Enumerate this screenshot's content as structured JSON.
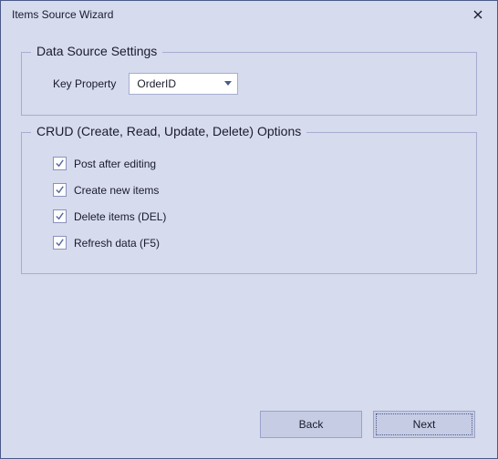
{
  "window": {
    "title": "Items Source Wizard"
  },
  "dataSource": {
    "legend": "Data Source Settings",
    "keyPropertyLabel": "Key Property",
    "keyPropertyValue": "OrderID"
  },
  "crud": {
    "legend": "CRUD (Create, Read, Update, Delete) Options",
    "options": [
      {
        "label": "Post after editing",
        "checked": true
      },
      {
        "label": "Create new items",
        "checked": true
      },
      {
        "label": "Delete items (DEL)",
        "checked": true
      },
      {
        "label": "Refresh data (F5)",
        "checked": true
      }
    ]
  },
  "buttons": {
    "back": "Back",
    "next": "Next"
  }
}
